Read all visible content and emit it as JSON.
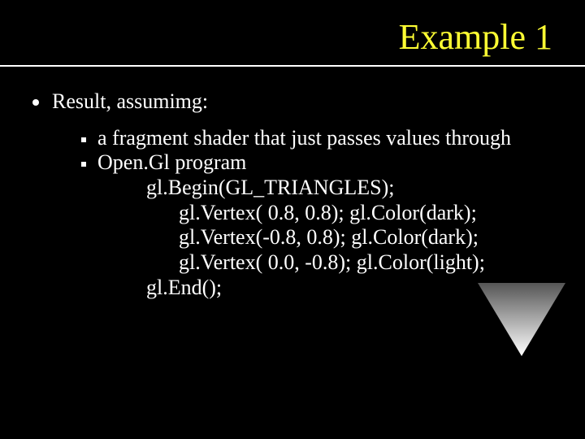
{
  "title": "Example 1",
  "bullet": "Result, assumimg:",
  "sub1": "a fragment shader that just passes values through",
  "sub2": "Open.Gl program",
  "code": {
    "l1": "gl.Begin(GL_TRIANGLES);",
    "l2": "gl.Vertex( 0.8,  0.8); gl.Color(dark);",
    "l3": "gl.Vertex(-0.8,  0.8); gl.Color(dark);",
    "l4": "gl.Vertex( 0.0, -0.8); gl.Color(light);",
    "l5": "gl.End();"
  },
  "triangle": {
    "top_left_color": "#555555",
    "top_right_color": "#555555",
    "bottom_color": "#ffffff"
  }
}
